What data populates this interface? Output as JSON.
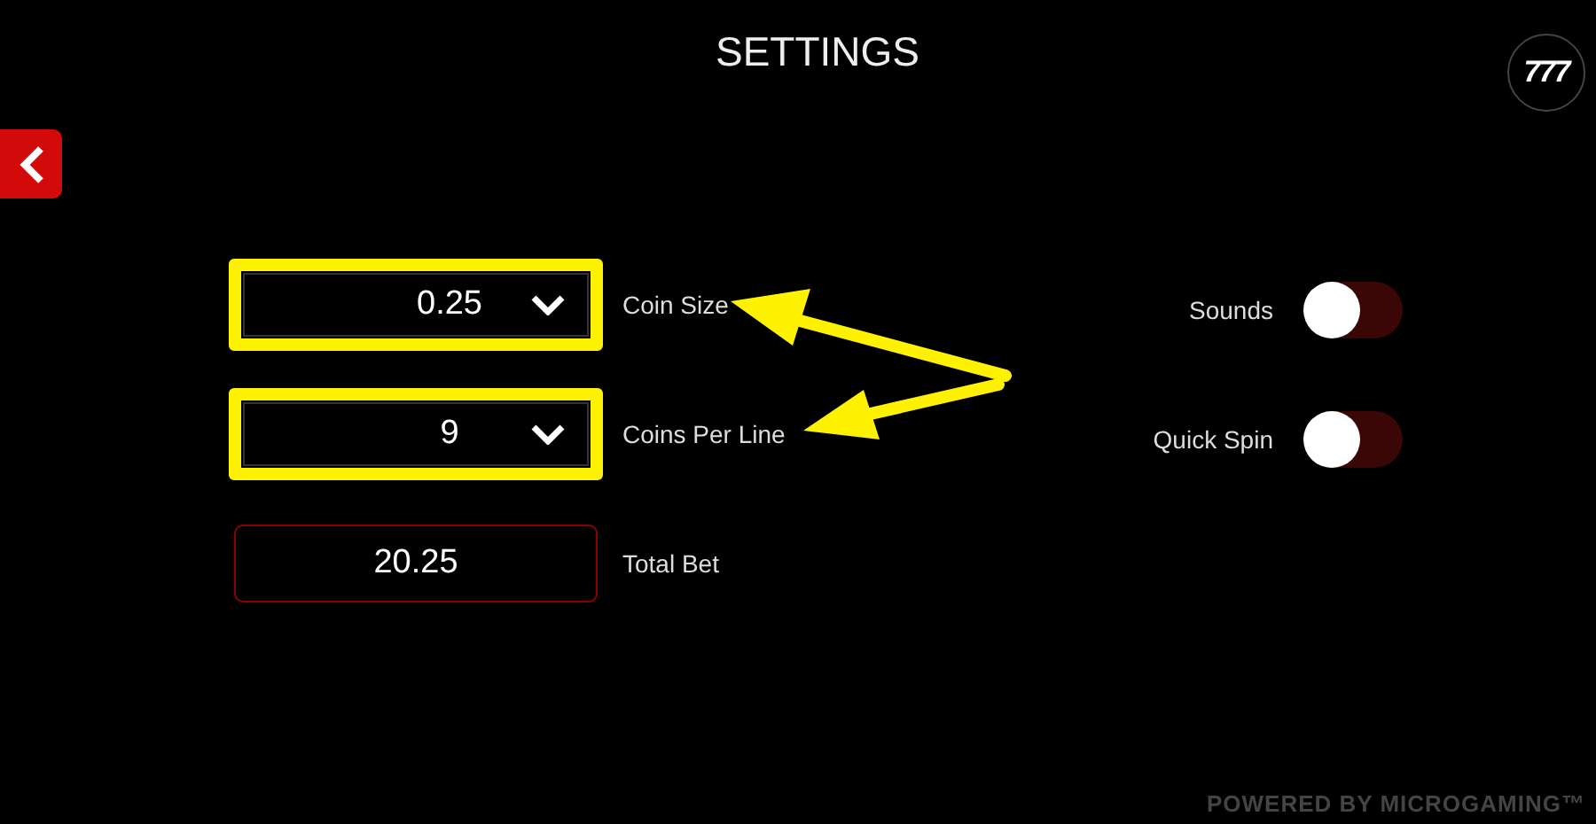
{
  "title": "SETTINGS",
  "badge": "777",
  "bet_fields": [
    {
      "kind": "dropdown",
      "value": "0.25",
      "label": "Coin Size",
      "highlighted": true
    },
    {
      "kind": "dropdown",
      "value": "9",
      "label": "Coins Per Line",
      "highlighted": true
    },
    {
      "kind": "display",
      "value": "20.25",
      "label": "Total Bet",
      "highlighted": false
    }
  ],
  "toggles": [
    {
      "label": "Sounds",
      "on": false
    },
    {
      "label": "Quick Spin",
      "on": false
    }
  ],
  "footer": "POWERED BY MICROGAMING™"
}
